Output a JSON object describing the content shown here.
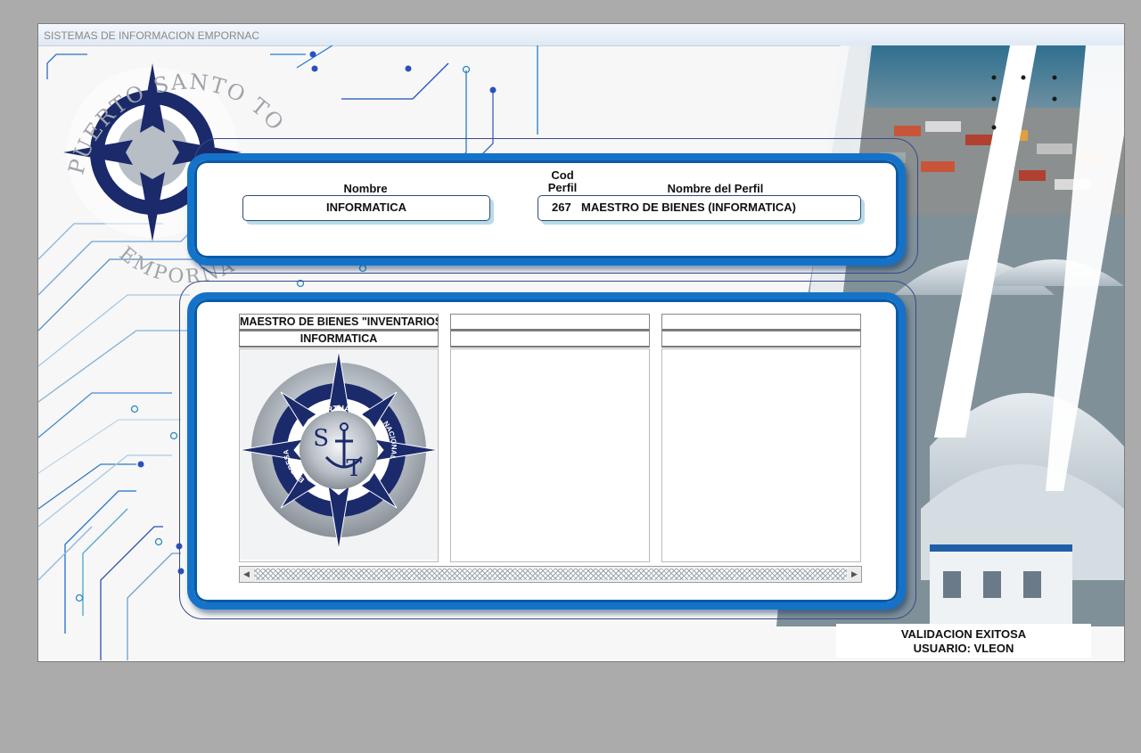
{
  "window": {
    "title": "SISTEMAS DE INFORMACION EMPORNAC"
  },
  "logo": {
    "arc_top": "PUERTO SANTO TOMAS DE CASTILLA",
    "arc_bottom": "EMPORNAC",
    "ring_top": "PORTUARIA",
    "ring_left": "EMPRESA",
    "ring_right": "NACIONAL",
    "monogram": "ST"
  },
  "profile": {
    "nombre_label": "Nombre",
    "nombre_value": "INFORMATICA",
    "cod_label_line1": "Cod",
    "cod_label_line2": "Perfil",
    "perfil_label": "Nombre del Perfil",
    "cod_value": "267",
    "perfil_value": "MAESTRO DE BIENES (INFORMATICA)"
  },
  "modules": [
    {
      "title": "MAESTRO DE BIENES \"INVENTARIOS\"",
      "subtitle": "INFORMATICA",
      "has_logo": true
    },
    {
      "title": "",
      "subtitle": "",
      "has_logo": false
    },
    {
      "title": "",
      "subtitle": "",
      "has_logo": false
    }
  ],
  "status": {
    "line1": "VALIDACION EXITOSA",
    "line2": "USUARIO: VLEON"
  },
  "colors": {
    "panel_blue": "#1473c8",
    "navy": "#1b2a6b",
    "window_bg": "#ababab"
  },
  "icons": {
    "scroll_left": "scroll-left-arrow-icon",
    "scroll_right": "scroll-right-arrow-icon"
  }
}
